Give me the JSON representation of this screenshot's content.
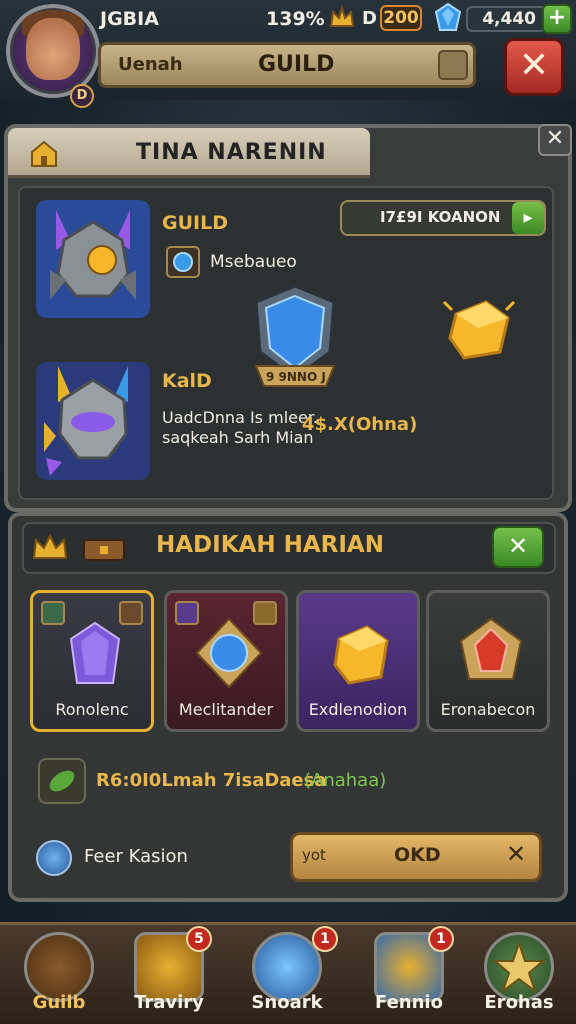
{
  "header": {
    "player_name": "JGBIA",
    "level_badge": "D",
    "percent": "139%",
    "crown_value": "D",
    "gold": "200",
    "gems": "4,440",
    "add_label": "+",
    "title_left": "Uenah",
    "title_center": "GUILD",
    "close_label": "✕"
  },
  "panel": {
    "tab_title": "TINA NARENIN",
    "close_label": "✕",
    "action_label": "I7£9I KOANON",
    "guild_label": "GUILD",
    "sub_label": "Msebaueo",
    "hero2_label": "KalD",
    "desc_line1": "UadcDnna Is mleer.",
    "desc_line2": "saqkeah Sarh Mian",
    "desc_reward": "4$.X(Ohna)",
    "ribbon_text": "9 9NNO J"
  },
  "daily": {
    "title": "HADIKAH HARIAN",
    "close_label": "✕",
    "items": [
      {
        "label": "Ronolenc",
        "color": "#7a5ad8"
      },
      {
        "label": "Meclitander",
        "color": "#3a8ad8"
      },
      {
        "label": "Exdlenodion",
        "color": "#e8b030"
      },
      {
        "label": "Eronabecon",
        "color": "#d83a2a"
      }
    ],
    "info_text": "R6:0I0Lmah 7isaDaesa",
    "info_green": "(Anahaa)",
    "feature_label": "Feer Kasion",
    "claim_small": "yot",
    "claim_label": "OKD",
    "claim_x": "✕"
  },
  "nav": [
    {
      "label": "Guilb",
      "badge": "",
      "active": true
    },
    {
      "label": "Traviry",
      "badge": "5"
    },
    {
      "label": "Snoark",
      "badge": "1"
    },
    {
      "label": "Fennio",
      "badge": "1"
    },
    {
      "label": "Erohas",
      "badge": ""
    }
  ]
}
